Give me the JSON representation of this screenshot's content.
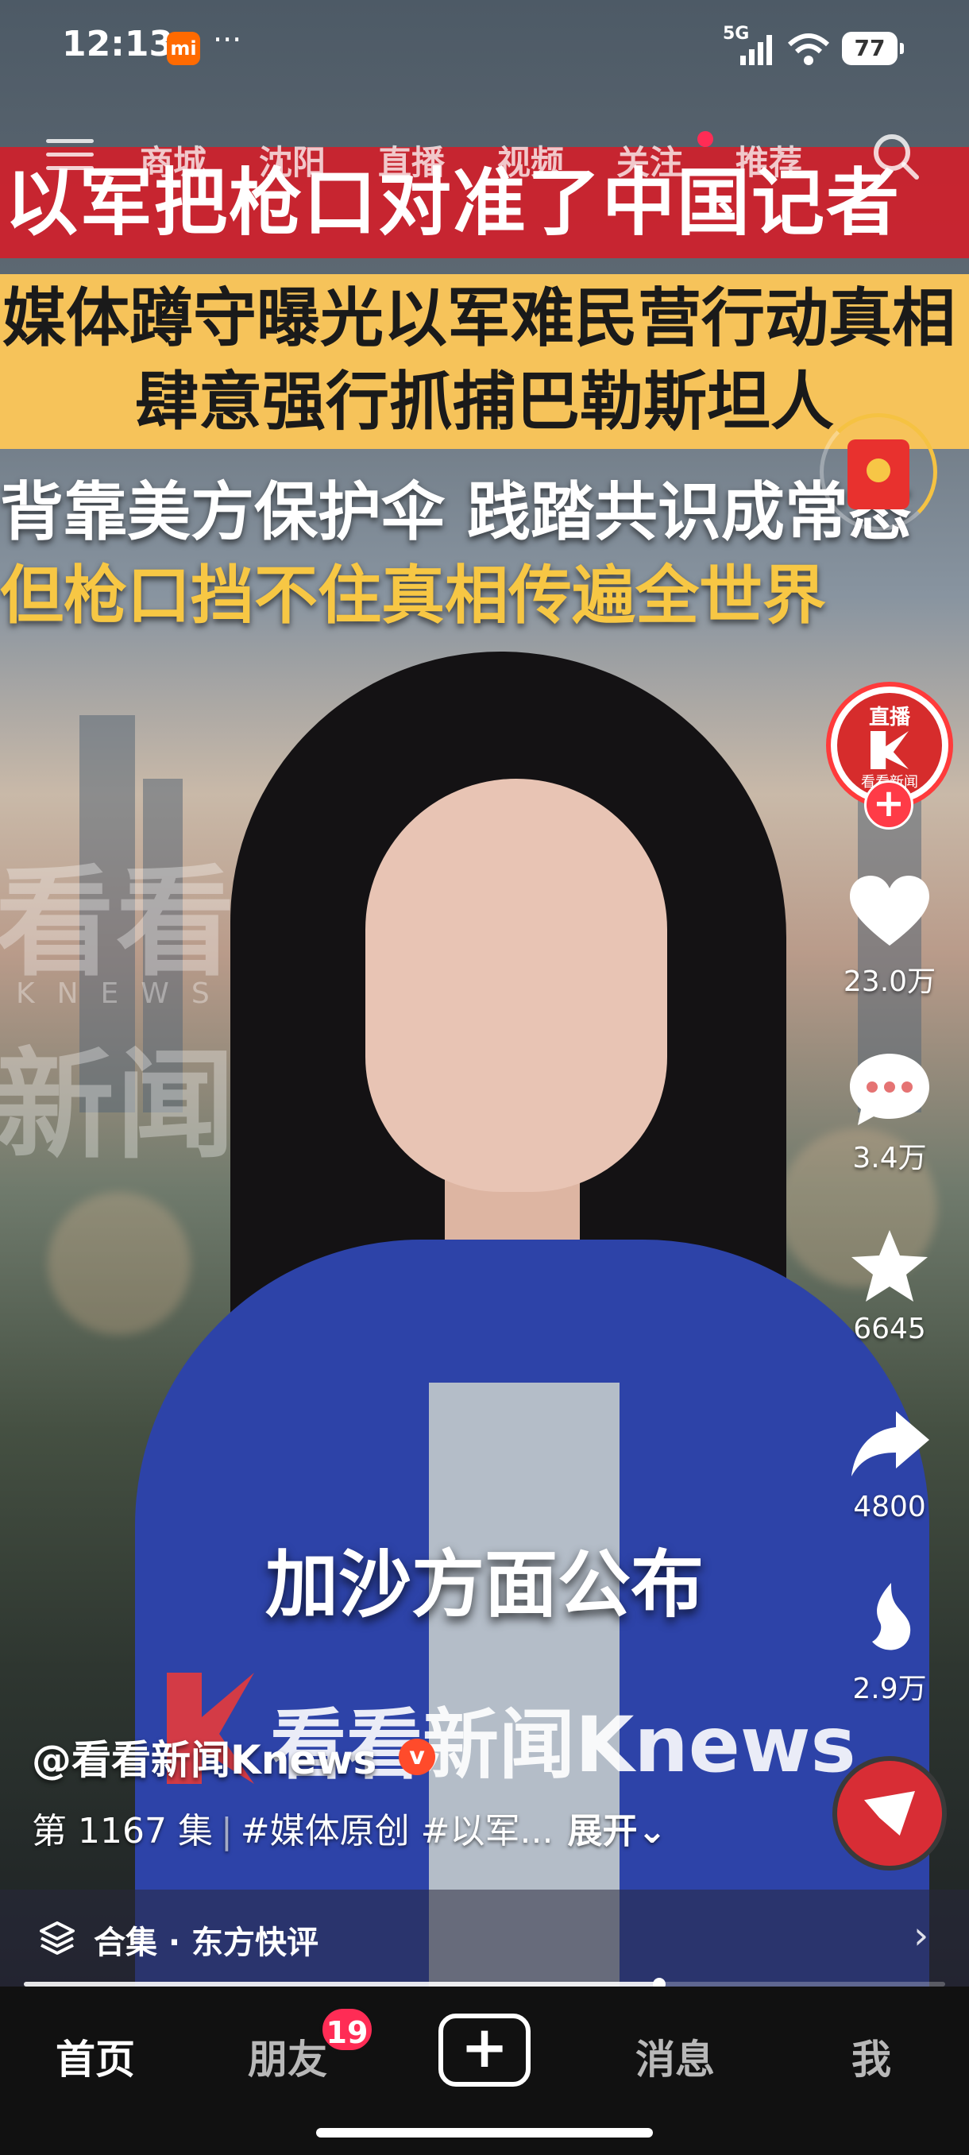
{
  "status_bar": {
    "time": "12:13",
    "mi": "mi",
    "more": "···",
    "network": "5G",
    "battery": "77"
  },
  "top_nav": {
    "tabs": [
      "商城",
      "沈阳",
      "直播",
      "视频",
      "关注",
      "推荐"
    ]
  },
  "headline": {
    "red_banner": "以军把枪口对准了中国记者",
    "yellow_line1": "媒体蹲守曝光以军难民营行动真相",
    "yellow_line2": "肆意强行抓捕巴勒斯坦人",
    "white_line": "背靠美方保护伞 践踏共识成常态",
    "yellow_text": "但枪口挡不住真相传遍全世界"
  },
  "watermark": {
    "line1": "看看",
    "line2": "KNEWS",
    "line3": "新闻"
  },
  "live": {
    "label": "直播",
    "sub": "看看新闻",
    "plus": "+"
  },
  "actions": {
    "like": "23.0万",
    "comment": "3.4万",
    "favorite": "6645",
    "share": "4800",
    "recommend": "2.9万"
  },
  "video": {
    "caption": "加沙方面公布",
    "logo_text": "看看新闻Knews"
  },
  "post": {
    "author": "@看看新闻Knews",
    "verified": "v",
    "episode": "第 1167 集",
    "separator": "|",
    "tags": "#媒体原创 #以军...",
    "expand": "展开⌄"
  },
  "collection": {
    "label": "合集 · 东方快评",
    "chevron": "›"
  },
  "progress": {
    "fraction": 0.69
  },
  "bottom_nav": {
    "home": "首页",
    "friends": "朋友",
    "friends_badge": "19",
    "create": "+",
    "messages": "消息",
    "me": "我"
  }
}
